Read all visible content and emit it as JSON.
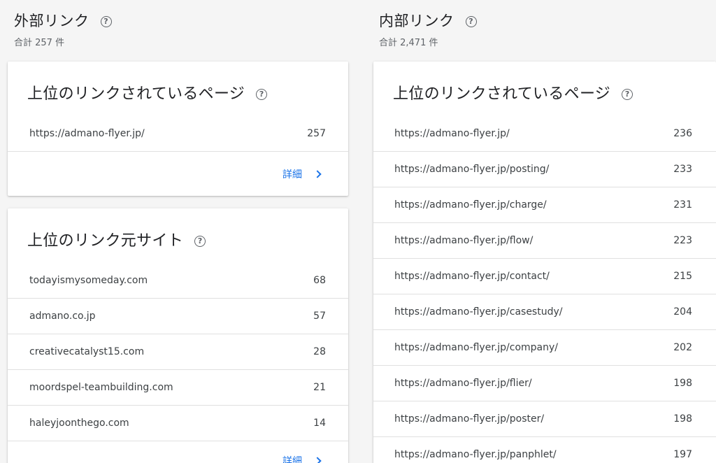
{
  "external": {
    "title": "外部リンク",
    "total": "合計 257 件",
    "top_pages": {
      "title": "上位のリンクされているページ",
      "rows": [
        {
          "url": "https://admano-flyer.jp/",
          "count": "257"
        }
      ],
      "detail": "詳細"
    },
    "top_sites": {
      "title": "上位のリンク元サイト",
      "rows": [
        {
          "url": "todayismysomeday.com",
          "count": "68"
        },
        {
          "url": "admano.co.jp",
          "count": "57"
        },
        {
          "url": "creativecatalyst15.com",
          "count": "28"
        },
        {
          "url": "moordspel-teambuilding.com",
          "count": "21"
        },
        {
          "url": "haleyjoonthego.com",
          "count": "14"
        }
      ],
      "detail": "詳細"
    }
  },
  "internal": {
    "title": "内部リンク",
    "total": "合計 2,471 件",
    "top_pages": {
      "title": "上位のリンクされているページ",
      "rows": [
        {
          "url": "https://admano-flyer.jp/",
          "count": "236"
        },
        {
          "url": "https://admano-flyer.jp/posting/",
          "count": "233"
        },
        {
          "url": "https://admano-flyer.jp/charge/",
          "count": "231"
        },
        {
          "url": "https://admano-flyer.jp/flow/",
          "count": "223"
        },
        {
          "url": "https://admano-flyer.jp/contact/",
          "count": "215"
        },
        {
          "url": "https://admano-flyer.jp/casestudy/",
          "count": "204"
        },
        {
          "url": "https://admano-flyer.jp/company/",
          "count": "202"
        },
        {
          "url": "https://admano-flyer.jp/flier/",
          "count": "198"
        },
        {
          "url": "https://admano-flyer.jp/poster/",
          "count": "198"
        },
        {
          "url": "https://admano-flyer.jp/panphlet/",
          "count": "197"
        }
      ]
    }
  },
  "icons": {
    "help": "help-circle-icon",
    "chevron": "chevron-right-icon"
  },
  "colors": {
    "link": "#1a73e8",
    "background": "#f5f5f5"
  }
}
